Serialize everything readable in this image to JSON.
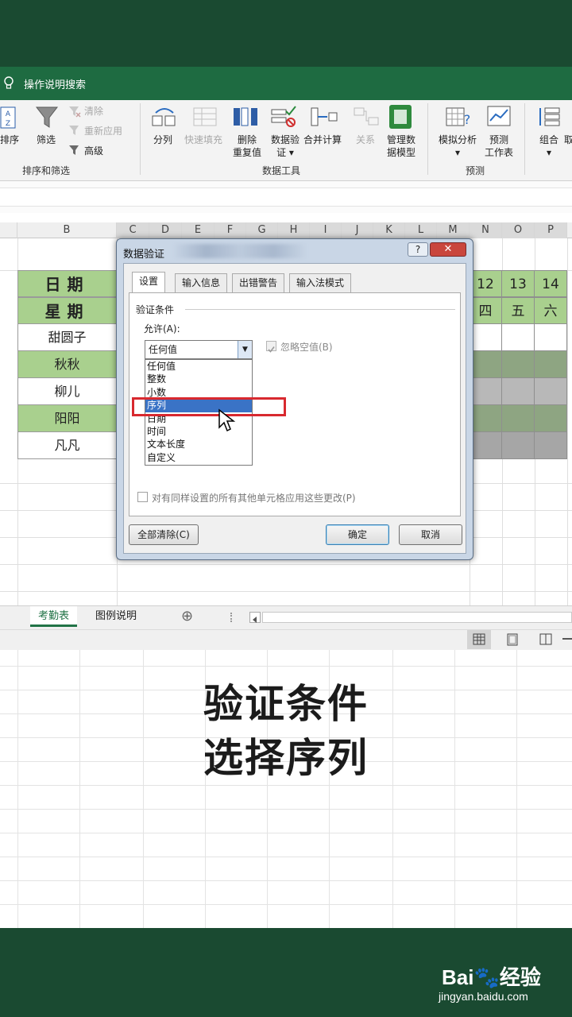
{
  "ribbon": {
    "search_label": "操作说明搜索",
    "sort_label": "排序",
    "filter_label": "筛选",
    "clear_label": "清除",
    "reapply_label": "重新应用",
    "advanced_label": "高级",
    "group_sort_filter": "排序和筛选",
    "split_label": "分列",
    "flash_fill_label": "快速填充",
    "remove_dup_label": [
      "删除",
      "重复值"
    ],
    "data_validation_label": [
      "数据验",
      "证 ▾"
    ],
    "consolidate_label": "合并计算",
    "relationships_label": "关系",
    "data_model_label": [
      "管理数",
      "据模型"
    ],
    "group_data_tools": "数据工具",
    "what_if_label": [
      "模拟分析",
      "▾"
    ],
    "forecast_label": [
      "预测",
      "工作表"
    ],
    "group_forecast": "预测",
    "group_label": [
      "组合",
      "▾"
    ],
    "ungroup_partial": "取"
  },
  "sheet": {
    "columns": [
      "B",
      "C",
      "D",
      "E",
      "F",
      "G",
      "H",
      "I",
      "J",
      "K",
      "L",
      "M",
      "N",
      "O",
      "P"
    ],
    "header_row1": "日期",
    "header_row2": "星期",
    "names": [
      "甜圆子",
      "秋秋",
      "柳儿",
      "阳阳",
      "凡凡"
    ],
    "day_numbers": [
      "12",
      "13",
      "14"
    ],
    "weekdays": [
      "四",
      "五",
      "六"
    ]
  },
  "dialog": {
    "title": "数据验证",
    "help": "?",
    "close": "✕",
    "tabs": [
      "设置",
      "输入信息",
      "出错警告",
      "输入法模式"
    ],
    "section_label": "验证条件",
    "allow_label": "允许(A):",
    "allow_value": "任何值",
    "ignore_blank_label": "忽略空值(B)",
    "options": [
      "任何值",
      "整数",
      "小数",
      "序列",
      "日期",
      "时间",
      "文本长度",
      "自定义"
    ],
    "selected_option": "序列",
    "apply_all_label": "对有同样设置的所有其他单元格应用这些更改(P)",
    "clear_all_button": "全部清除(C)",
    "ok_button": "确定",
    "cancel_button": "取消"
  },
  "sheet_tabs": {
    "active": "考勤表",
    "other": "图例说明",
    "add": "⊕"
  },
  "caption": {
    "line1": "验证条件",
    "line2": "选择序列"
  },
  "watermark": {
    "brand": "Bai🐾经验",
    "url": "jingyan.baidu.com"
  },
  "colors": {
    "excel_green": "#217346",
    "header_fill": "#a9d08e",
    "selection_blue": "#3a73c6",
    "highlight_red": "#d8292f"
  }
}
